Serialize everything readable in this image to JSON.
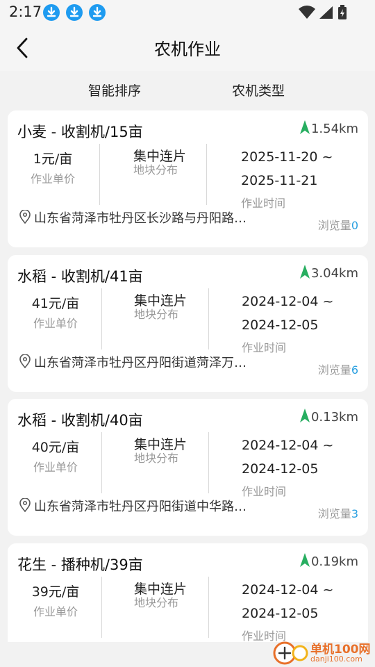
{
  "status_bar": {
    "time": "2:17",
    "notification_icons": [
      "download-icon",
      "download-icon",
      "download-icon"
    ],
    "system_icons": [
      "wifi-icon",
      "signal-icon",
      "battery-icon"
    ]
  },
  "nav": {
    "back_icon": "chevron-left-icon",
    "title": "农机作业"
  },
  "filters": {
    "sort_label": "智能排序",
    "type_label": "农机类型"
  },
  "labels": {
    "price": "作业单价",
    "distribution": "地块分布",
    "time": "作业时间",
    "views": "浏览量"
  },
  "cards": [
    {
      "title": "小麦 - 收割机/15亩",
      "distance": "1.54km",
      "price": "1元/亩",
      "distribution": "集中连片",
      "date_start": "2025-11-20 ~",
      "date_end": "2025-11-21",
      "location": "山东省菏泽市牡丹区长沙路与丹阳路…",
      "views": "0"
    },
    {
      "title": "水稻 - 收割机/41亩",
      "distance": "3.04km",
      "price": "41元/亩",
      "distribution": "集中连片",
      "date_start": "2024-12-04 ~",
      "date_end": "2024-12-05",
      "location": "山东省菏泽市牡丹区丹阳街道菏泽万…",
      "views": "6"
    },
    {
      "title": "水稻 - 收割机/40亩",
      "distance": "0.13km",
      "price": "40元/亩",
      "distribution": "集中连片",
      "date_start": "2024-12-04 ~",
      "date_end": "2024-12-05",
      "location": "山东省菏泽市牡丹区丹阳街道中华路…",
      "views": "3"
    },
    {
      "title": "花生 - 播种机/39亩",
      "distance": "0.19km",
      "price": "39元/亩",
      "distribution": "集中连片",
      "date_start": "2024-12-04 ~",
      "date_end": "2024-12-05",
      "location": "",
      "views": ""
    }
  ],
  "watermark": {
    "line1": "单机100网",
    "line2": "danji100.com"
  },
  "colors": {
    "accent_green": "#27ae60",
    "link_blue": "#2aa0e0",
    "download_blue": "#1e9bf0",
    "watermark_orange": "#e8702a"
  }
}
